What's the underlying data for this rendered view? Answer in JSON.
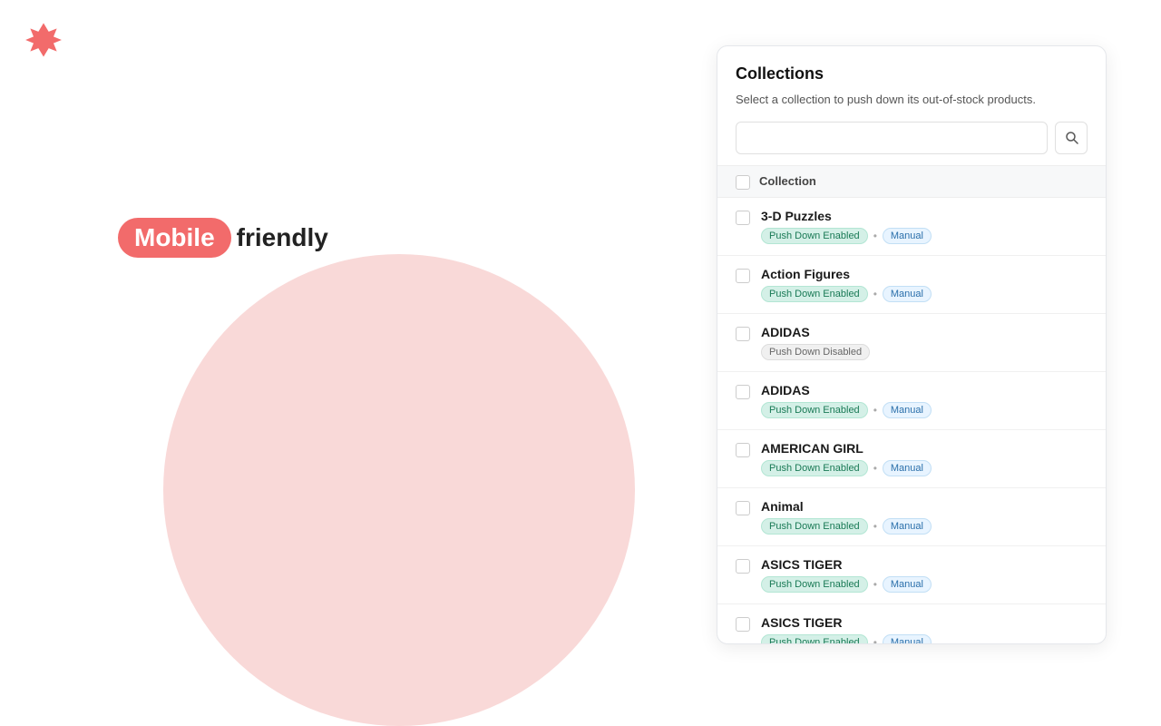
{
  "logo": {
    "alt": "Brand Logo"
  },
  "tagline": {
    "mobile": "Mobile",
    "friendly": "friendly"
  },
  "panel": {
    "title": "Collections",
    "description": "Select a collection to push down its out-of-stock products.",
    "search": {
      "placeholder": "",
      "button_icon": "🔍"
    },
    "header": {
      "label": "Collection"
    },
    "items": [
      {
        "name": "3-D Puzzles",
        "status": "Push Down Enabled",
        "status_type": "enabled",
        "extra": "Manual"
      },
      {
        "name": "Action Figures",
        "status": "Push Down Enabled",
        "status_type": "enabled",
        "extra": "Manual"
      },
      {
        "name": "ADIDAS",
        "status": "Push Down Disabled",
        "status_type": "disabled",
        "extra": null
      },
      {
        "name": "ADIDAS",
        "status": "Push Down Enabled",
        "status_type": "enabled",
        "extra": "Manual"
      },
      {
        "name": "AMERICAN GIRL",
        "status": "Push Down Enabled",
        "status_type": "enabled",
        "extra": "Manual"
      },
      {
        "name": "Animal",
        "status": "Push Down Enabled",
        "status_type": "enabled",
        "extra": "Manual"
      },
      {
        "name": "ASICS TIGER",
        "status": "Push Down Enabled",
        "status_type": "enabled",
        "extra": "Manual"
      },
      {
        "name": "ASICS TIGER",
        "status": "Push Down Enabled",
        "status_type": "enabled",
        "extra": "Manual"
      }
    ]
  },
  "colors": {
    "brand_red": "#f26b6b",
    "blob_pink": "#f5c0be"
  }
}
